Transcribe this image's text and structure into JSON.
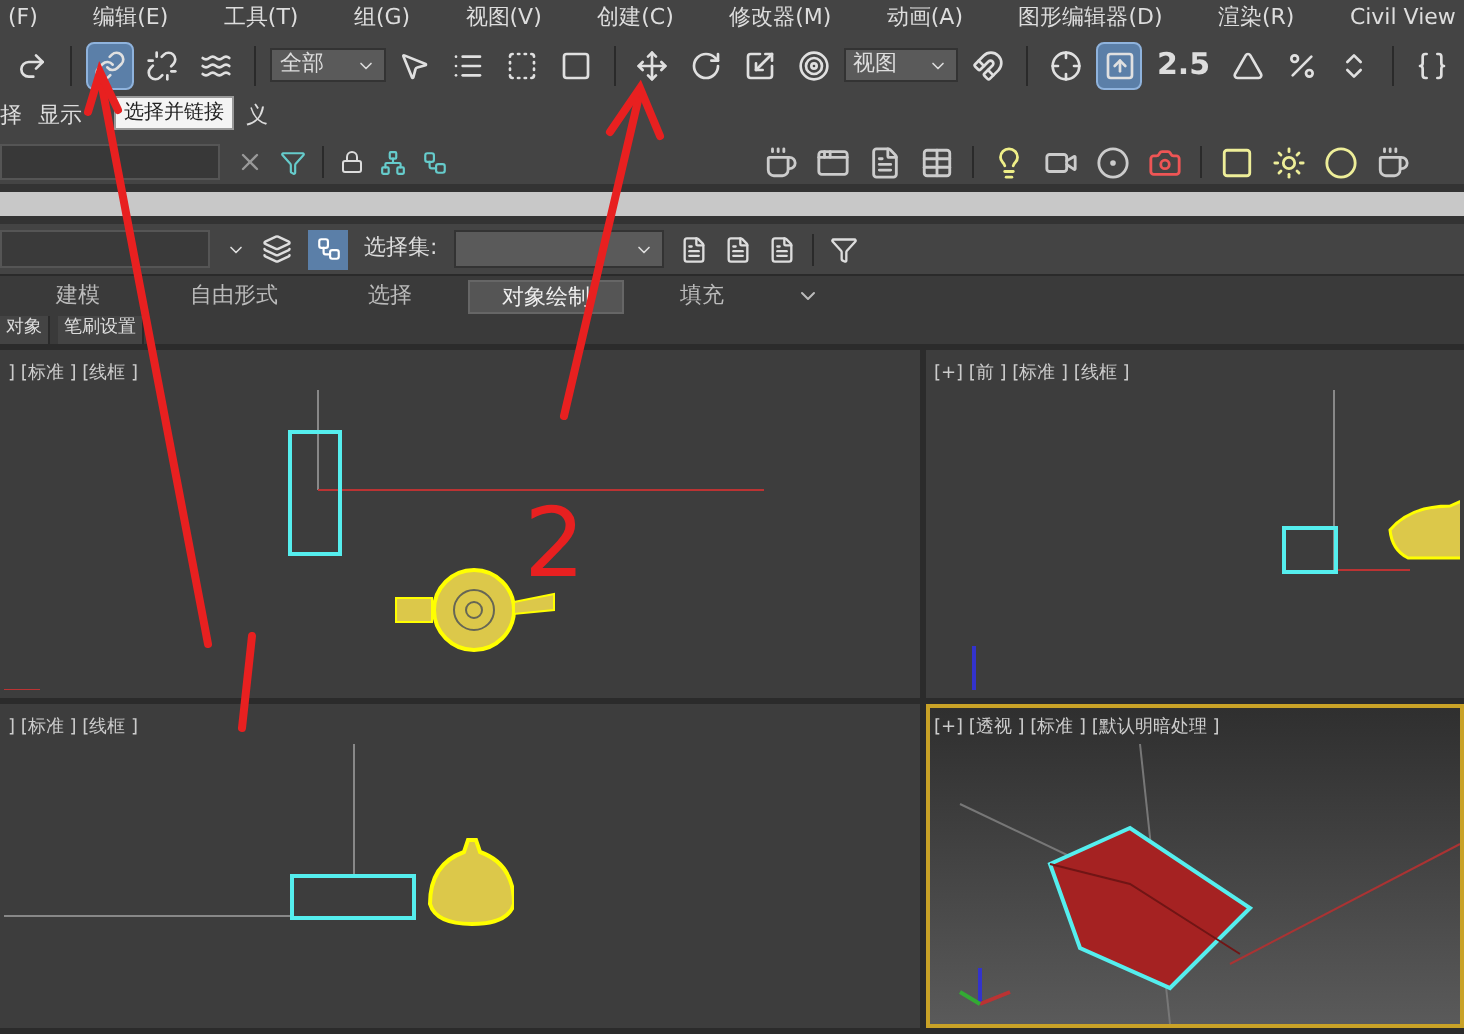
{
  "menu_bar": {
    "items": [
      "(F)",
      "编辑(E)",
      "工具(T)",
      "组(G)",
      "视图(V)",
      "创建(C)",
      "修改器(M)",
      "动画(A)",
      "图形编辑器(D)",
      "渲染(R)",
      "Civil View"
    ]
  },
  "main_toolbar": {
    "items": [
      {
        "kind": "redo",
        "selected": false
      },
      {
        "kind": "separator"
      },
      {
        "kind": "link",
        "selected": true
      },
      {
        "kind": "unlink",
        "selected": false
      },
      {
        "kind": "bind",
        "selected": false
      },
      {
        "kind": "separator"
      },
      {
        "kind": "dropdown",
        "value": "全部"
      },
      {
        "kind": "select",
        "selected": false
      },
      {
        "kind": "select_by_name",
        "selected": false
      },
      {
        "kind": "region",
        "selected": false
      },
      {
        "kind": "window",
        "selected": false
      },
      {
        "kind": "separator"
      },
      {
        "kind": "move",
        "selected": false
      },
      {
        "kind": "rotate",
        "selected": false
      },
      {
        "kind": "scale",
        "selected": false
      },
      {
        "kind": "placement",
        "selected": false
      },
      {
        "kind": "dropdown",
        "value": "视图"
      },
      {
        "kind": "pivot",
        "selected": false
      },
      {
        "kind": "separator"
      },
      {
        "kind": "manipulate",
        "selected": false
      },
      {
        "kind": "keyboard",
        "selected": true
      },
      {
        "kind": "snap",
        "label": "2.5",
        "selected": false
      },
      {
        "kind": "angle",
        "selected": false
      },
      {
        "kind": "percent",
        "selected": false
      },
      {
        "kind": "spinner",
        "selected": false
      },
      {
        "kind": "separator"
      },
      {
        "kind": "braces",
        "selected": false
      }
    ]
  },
  "tooltip": {
    "text": "选择并链接"
  },
  "ribbon_row": {
    "items": [
      "择",
      "显示",
      "义"
    ]
  },
  "selection_toolbar": {
    "label": "选择集:"
  },
  "ribbon_tabs": [
    {
      "label": "建模",
      "selected": false
    },
    {
      "label": "自由形式",
      "selected": false
    },
    {
      "label": "选择",
      "selected": false
    },
    {
      "label": "对象绘制",
      "selected": true
    },
    {
      "label": "填充",
      "selected": false
    }
  ],
  "ribbon_subtabs": [
    "对象",
    "笔刷设置"
  ],
  "viewports": [
    {
      "kind": "top",
      "label": "] [标准 ] [线框 ]",
      "active": false
    },
    {
      "kind": "front",
      "label": "[+] [前 ] [标准 ] [线框 ]",
      "active": false
    },
    {
      "kind": "left",
      "label": "] [标准 ] [线框 ]",
      "active": false
    },
    {
      "kind": "perspective",
      "label": "[+] [透视 ] [标准 ] [默认明暗处理 ]",
      "active": true
    }
  ],
  "annotation": {
    "label": "2"
  }
}
